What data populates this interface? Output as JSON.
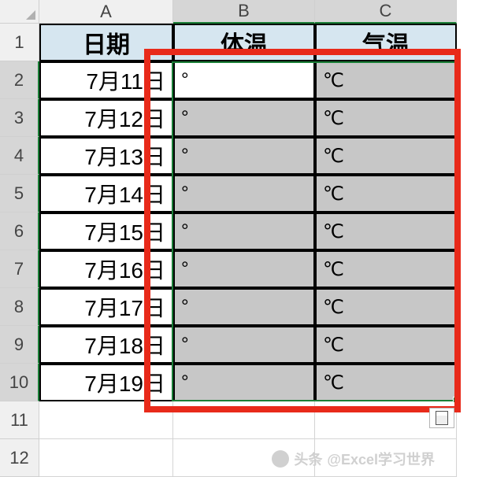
{
  "columns": {
    "A": "A",
    "B": "B",
    "C": "C"
  },
  "rows": [
    "1",
    "2",
    "3",
    "4",
    "5",
    "6",
    "7",
    "8",
    "9",
    "10",
    "11",
    "12"
  ],
  "table": {
    "headers": {
      "date": "日期",
      "body_temp": "体温",
      "air_temp": "气温"
    },
    "data": [
      {
        "date": "7月11日",
        "body_temp": "°",
        "air_temp": "℃"
      },
      {
        "date": "7月12日",
        "body_temp": "°",
        "air_temp": "℃"
      },
      {
        "date": "7月13日",
        "body_temp": "°",
        "air_temp": "℃"
      },
      {
        "date": "7月14日",
        "body_temp": "°",
        "air_temp": "℃"
      },
      {
        "date": "7月15日",
        "body_temp": "°",
        "air_temp": "℃"
      },
      {
        "date": "7月16日",
        "body_temp": "°",
        "air_temp": "℃"
      },
      {
        "date": "7月17日",
        "body_temp": "°",
        "air_temp": "℃"
      },
      {
        "date": "7月18日",
        "body_temp": "°",
        "air_temp": "℃"
      },
      {
        "date": "7月19日",
        "body_temp": "°",
        "air_temp": "℃"
      }
    ]
  },
  "watermark": {
    "prefix": "头条",
    "author": "@Excel学习世界"
  }
}
